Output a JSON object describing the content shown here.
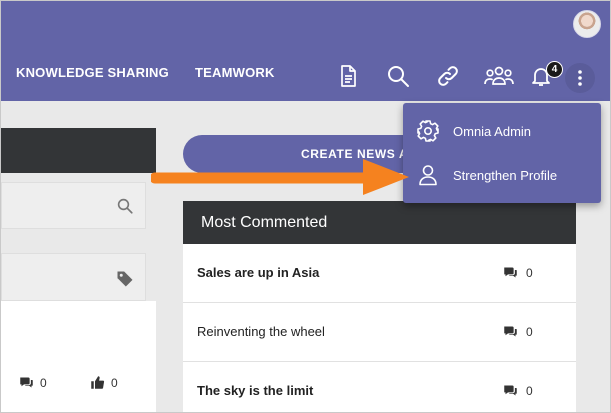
{
  "nav": {
    "items": [
      "KNOWLEDGE SHARING",
      "TEAMWORK"
    ]
  },
  "header": {
    "icons": [
      "document-icon",
      "search-icon",
      "link-icon",
      "people-icon",
      "bell-icon",
      "more-icon"
    ],
    "notification_count": "4",
    "accent": "#6264a7"
  },
  "create_news": {
    "label": "CREATE NEWS A"
  },
  "most_commented": {
    "title": "Most Commented",
    "rows": [
      {
        "title": "Sales are up in Asia",
        "count": "0",
        "bold": true
      },
      {
        "title": "Reinventing the wheel",
        "count": "0",
        "bold": false
      },
      {
        "title": "The sky is the limit",
        "count": "0",
        "bold": true
      }
    ]
  },
  "left_card": {
    "comments": "0",
    "likes": "0"
  },
  "menu": {
    "items": [
      {
        "label": "Omnia Admin",
        "icon": "gear-icon"
      },
      {
        "label": "Strengthen Profile",
        "icon": "user-icon"
      }
    ]
  },
  "annotation": {
    "arrow_color": "#f5821f"
  }
}
